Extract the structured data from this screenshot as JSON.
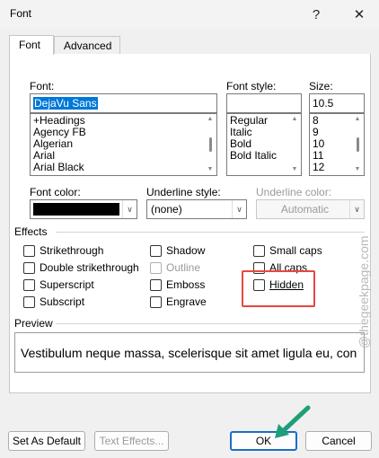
{
  "window": {
    "title": "Font",
    "help_glyph": "?",
    "close_glyph": "✕"
  },
  "tabs": [
    {
      "label": "Font",
      "active": true
    },
    {
      "label": "Advanced",
      "active": false
    }
  ],
  "font": {
    "label": "Font:",
    "value": "DejaVu Sans",
    "list": [
      "+Headings",
      "Agency FB",
      "Algerian",
      "Arial",
      "Arial Black"
    ]
  },
  "font_style": {
    "label": "Font style:",
    "value": "",
    "list": [
      "Regular",
      "Italic",
      "Bold",
      "Bold Italic"
    ]
  },
  "size": {
    "label": "Size:",
    "value": "10.5",
    "list": [
      "8",
      "9",
      "10",
      "11",
      "12"
    ]
  },
  "font_color": {
    "label": "Font color:",
    "swatch": "#000000"
  },
  "underline_style": {
    "label": "Underline style:",
    "value": "(none)"
  },
  "underline_color": {
    "label": "Underline color:",
    "value": "Automatic"
  },
  "effects": {
    "title": "Effects",
    "col1": [
      "Strikethrough",
      "Double strikethrough",
      "Superscript",
      "Subscript"
    ],
    "col2": [
      "Shadow",
      "Outline",
      "Emboss",
      "Engrave"
    ],
    "col3": [
      "Small caps",
      "All caps",
      "Hidden"
    ]
  },
  "preview": {
    "title": "Preview",
    "text": "Vestibulum neque massa, scelerisque sit amet ligula eu, con"
  },
  "buttons": {
    "set_default": "Set As Default",
    "text_effects": "Text Effects...",
    "ok": "OK",
    "cancel": "Cancel"
  },
  "watermark": "@thegeekpage.com",
  "colors": {
    "highlight": "#e8473f",
    "arrow": "#1f9e7a",
    "ok_border": "#1a6fc4"
  }
}
